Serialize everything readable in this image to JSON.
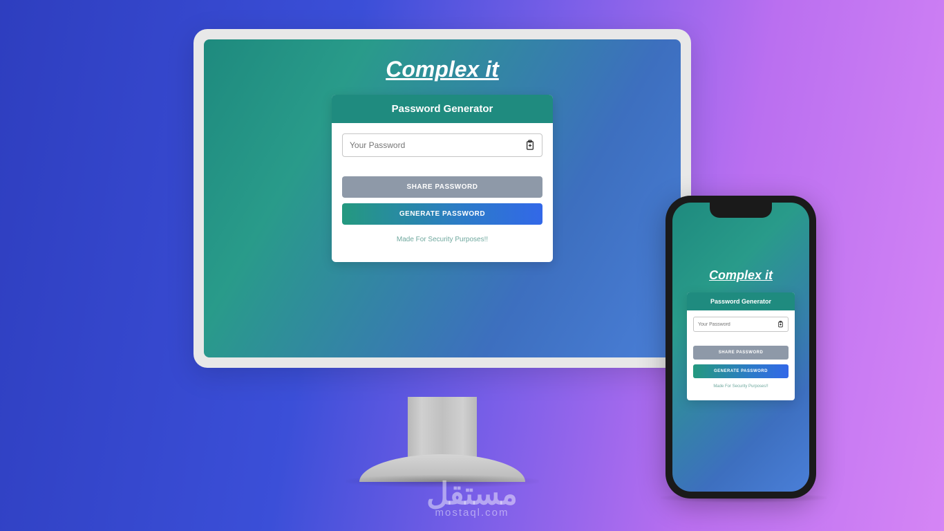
{
  "app": {
    "title": "Complex it",
    "card_header": "Password Generator",
    "input_placeholder": "Your Password",
    "share_button": "SHARE PASSWORD",
    "generate_button": "GENERATE PASSWORD",
    "footer": "Made For Security Purposes!!"
  },
  "watermark": {
    "arabic": "مستقل",
    "latin": "mostaql.com"
  }
}
